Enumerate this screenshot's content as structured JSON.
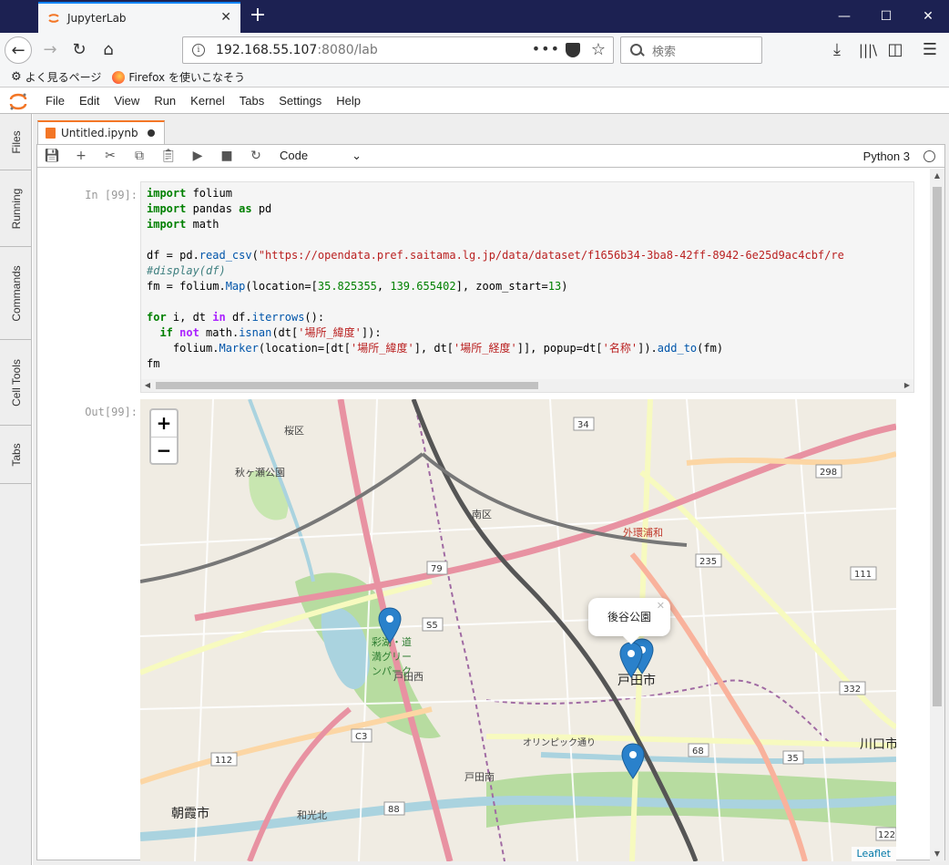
{
  "browser": {
    "tab_title": "JupyterLab",
    "url_host": "192.168.55.107",
    "url_rest": ":8080/lab",
    "search_placeholder": "検索",
    "bookmarks": [
      "よく見るページ",
      "Firefox を使いこなそう"
    ]
  },
  "jupyter": {
    "menu": [
      "File",
      "Edit",
      "View",
      "Run",
      "Kernel",
      "Tabs",
      "Settings",
      "Help"
    ],
    "sidebar_tabs": [
      "Files",
      "Running",
      "Commands",
      "Cell Tools",
      "Tabs"
    ],
    "document_tab": "Untitled.ipynb",
    "cell_type": "Code",
    "kernel": "Python 3",
    "in_prompt": "In [99]:",
    "out_prompt": "Out[99]:"
  },
  "code_lines": [
    "import folium",
    "import pandas as pd",
    "import math",
    "",
    "df = pd.read_csv(\"https://opendata.pref.saitama.lg.jp/data/dataset/f1656b34-3ba8-42ff-8942-6e25d9ac4cbf/re",
    "#display(df)",
    "fm = folium.Map(location=[35.825355, 139.655402], zoom_start=13)",
    "",
    "for i, dt in df.iterrows():",
    "  if not math.isnan(dt['場所_緯度']):",
    "    folium.Marker(location=[dt['場所_緯度'], dt['場所_経度']], popup=dt['名称']).add_to(fm)",
    "fm"
  ],
  "map": {
    "popup_text": "後谷公園",
    "attribution": "Leaflet",
    "zoom_in": "+",
    "zoom_out": "−",
    "labels": [
      {
        "text": "桜区"
      },
      {
        "text": "南区"
      },
      {
        "text": "戸田市"
      },
      {
        "text": "朝霞市"
      },
      {
        "text": "川口市"
      },
      {
        "text": "外環浦和"
      },
      {
        "text": "戸田西"
      },
      {
        "text": "戸田南"
      },
      {
        "text": "和光北"
      },
      {
        "text": "オリンピック通り"
      },
      {
        "text": "秋ヶ瀬公園"
      },
      {
        "text": "彩湖・道満グリーンパーク"
      }
    ],
    "route_shields": [
      "34",
      "79",
      "S5",
      "C3",
      "112",
      "88",
      "68",
      "35",
      "235",
      "298",
      "111",
      "332",
      "122"
    ],
    "marker_color": "#2a81cb"
  }
}
